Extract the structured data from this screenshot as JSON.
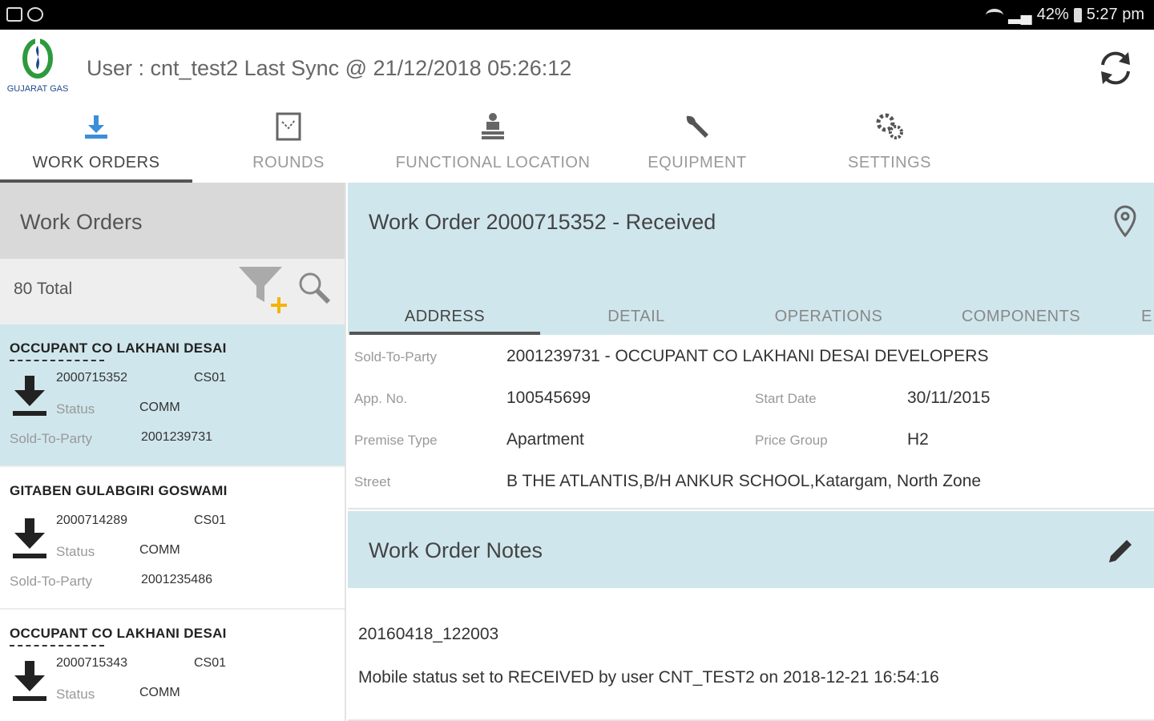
{
  "status_bar": {
    "battery": "42%",
    "time": "5:27 pm"
  },
  "header": {
    "logo_text": "GUJARAT GAS",
    "user_line": "User : cnt_test2 Last Sync @ 21/12/2018 05:26:12"
  },
  "tabs": [
    {
      "label": "WORK ORDERS",
      "icon": "download-icon",
      "active": true
    },
    {
      "label": "ROUNDS",
      "icon": "rounds-icon",
      "active": false
    },
    {
      "label": "FUNCTIONAL LOCATION",
      "icon": "functional-location-icon",
      "active": false
    },
    {
      "label": "EQUIPMENT",
      "icon": "wrench-icon",
      "active": false
    },
    {
      "label": "SETTINGS",
      "icon": "gear-icon",
      "active": false
    }
  ],
  "work_orders_panel": {
    "title": "Work Orders",
    "total": "80 Total",
    "items": [
      {
        "name": "OCCUPANT  CO LAKHANI  DESAI",
        "number": "2000715352",
        "plant": "CS01",
        "status_label": "Status",
        "status": "COMM",
        "stp_label": "Sold-To-Party",
        "stp": "2001239731",
        "selected": true
      },
      {
        "name": "GITABEN GULABGIRI GOSWAMI",
        "number": "2000714289",
        "plant": "CS01",
        "status_label": "Status",
        "status": "COMM",
        "stp_label": "Sold-To-Party",
        "stp": "2001235486",
        "selected": false
      },
      {
        "name": "OCCUPANT  CO LAKHANI  DESAI",
        "number": "2000715343",
        "plant": "CS01",
        "status_label": "Status",
        "status": "COMM",
        "stp_label": "",
        "stp": "",
        "selected": false
      }
    ]
  },
  "detail": {
    "title": "Work Order 2000715352 - Received",
    "subtabs": [
      "ADDRESS",
      "DETAIL",
      "OPERATIONS",
      "COMPONENTS",
      "E"
    ],
    "address": {
      "sold_to_party_label": "Sold-To-Party",
      "sold_to_party": "2001239731 - OCCUPANT  CO LAKHANI  DESAI DEVELOPERS",
      "app_no_label": "App. No.",
      "app_no": "100545699",
      "start_date_label": "Start Date",
      "start_date": "30/11/2015",
      "premise_type_label": "Premise Type",
      "premise_type": "Apartment",
      "price_group_label": "Price Group",
      "price_group": "H2",
      "street_label": "Street",
      "street": "B THE ATLANTIS,B/H ANKUR SCHOOL,Katargam, North Zone"
    },
    "notes": {
      "title": "Work Order Notes",
      "lines": [
        "20160418_122003",
        "Mobile status set to RECEIVED by user CNT_TEST2 on 2018-12-21 16:54:16"
      ]
    }
  },
  "colors": {
    "accent_light_blue": "#cfe6ec",
    "logo_green": "#2e9a3e",
    "logo_blue": "#1c4a8a",
    "filter_plus": "#f5b400"
  }
}
